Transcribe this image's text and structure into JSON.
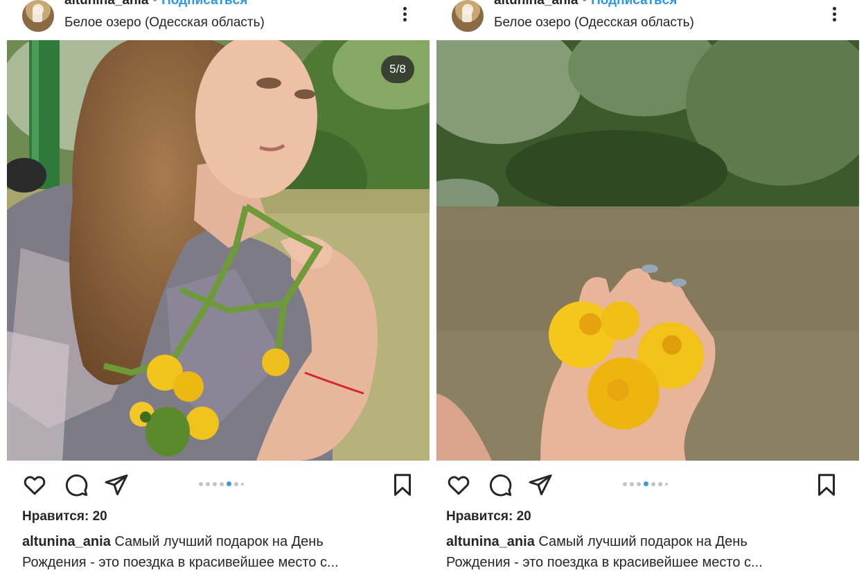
{
  "posts": [
    {
      "username": "altunina_ania",
      "separator": "•",
      "follow_label": "Подписаться",
      "location": "Белое озеро (Одесская область)",
      "counter": "5/8",
      "likes": "Нравится: 20",
      "caption_user": "altunina_ania",
      "caption_text": "Самый лучший подарок на День",
      "caption_text_2": "Рождения - это поездка в красивейшее место с...",
      "carousel_active_index": 3
    },
    {
      "username": "altunina_ania",
      "separator": "•",
      "follow_label": "Подписаться",
      "location": "Белое озеро (Одесская область)",
      "likes": "Нравится: 20",
      "caption_user": "altunina_ania",
      "caption_text": "Самый лучший подарок на День",
      "caption_text_2": "Рождения - это поездка в красивейшее место с...",
      "carousel_active_index": 3
    }
  ],
  "icons": [
    "more-options-icon",
    "heart-icon",
    "comment-icon",
    "share-icon",
    "bookmark-icon"
  ],
  "colors": {
    "follow": "#2a98e8",
    "active_dot": "#3b9ad9",
    "text": "#262626"
  }
}
